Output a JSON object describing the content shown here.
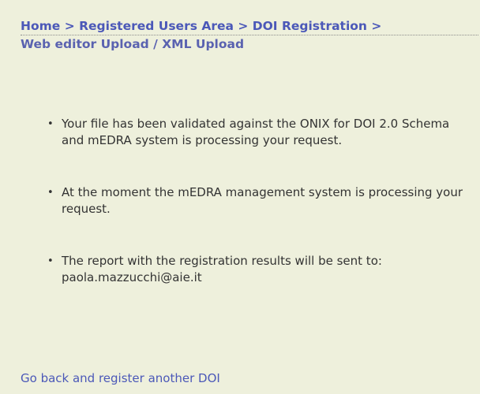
{
  "breadcrumb": {
    "home": "Home",
    "registered_users_area": "Registered Users Area",
    "doi_registration": "DOI Registration",
    "separator": ">",
    "current": "Web editor Upload / XML Upload"
  },
  "messages": [
    "Your file has been validated against the ONIX for DOI 2.0 Schema and mEDRA system is processing your request.",
    "At the moment the mEDRA management system is processing your request.",
    "The report with the registration results will be sent to: paola.mazzucchi@aie.it"
  ],
  "bullet": "•",
  "back_link": "Go back and register another DOI",
  "colors": {
    "background": "#eef0dc",
    "link": "#4b58b8",
    "text": "#333333"
  }
}
